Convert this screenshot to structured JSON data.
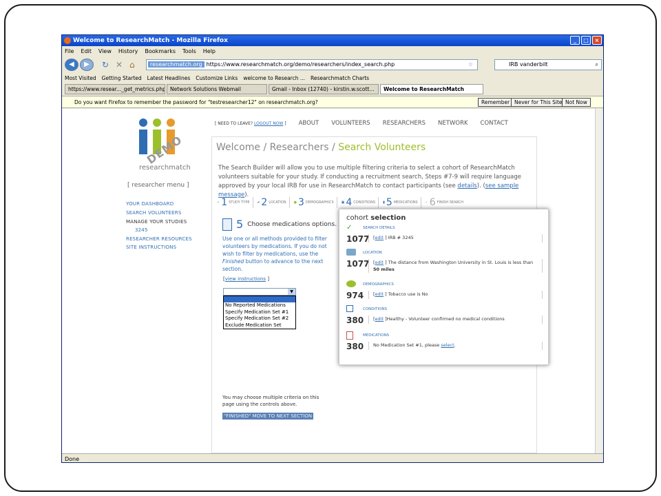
{
  "browser": {
    "title": "Welcome to ResearchMatch - Mozilla Firefox",
    "menu": [
      "File",
      "Edit",
      "View",
      "History",
      "Bookmarks",
      "Tools",
      "Help"
    ],
    "site_badge": "researchmatch.org",
    "url": "https://www.researchmatch.org/demo/researchers/index_search.php",
    "search_value": "IRB vanderbilt",
    "bookmarks": [
      "Most Visited",
      "Getting Started",
      "Latest Headlines",
      "Customize Links",
      "welcome to Research ...",
      "Researchmatch Charts"
    ],
    "tabs": [
      "https://www.resear..._get_metrics.php",
      "Network Solutions Webmail",
      "Gmail - Inbox (12740) - kirstin.w.scott...",
      "Welcome to ResearchMatch"
    ],
    "notification": "Do you want Firefox to remember the password for \"testresearcher12\" on researchmatch.org?",
    "buttons": {
      "remember": "Remember",
      "never": "Never for This Site",
      "not_now": "Not Now"
    },
    "status": "Done"
  },
  "page": {
    "logo_text": "researchmatch",
    "demo_stamp": "DEMO",
    "menu_title": "[ researcher menu ]",
    "menu_items": [
      "YOUR DASHBOARD",
      "SEARCH VOLUNTEERS",
      "MANAGE YOUR STUDIES",
      "3245",
      "RESEARCHER RESOURCES",
      "SITE INSTRUCTIONS"
    ],
    "need_leave": "[ NEED TO LEAVE?",
    "logout": "LOGOUT NOW",
    "need_leave_end": "]",
    "nav": [
      "ABOUT",
      "VOLUNTEERS",
      "RESEARCHERS",
      "NETWORK",
      "CONTACT"
    ],
    "breadcrumb": [
      "Welcome",
      "Researchers",
      "Search Volunteers"
    ],
    "intro_1": "The Search Builder will allow you to use multiple filtering criteria to select a cohort of ResearchMatch volunteers suitable for your study. If conducting a recruitment search, Steps #7-9 will require language approved by your local IRB for use in ResearchMatch to contact participants (see ",
    "intro_link1": "details",
    "intro_2": "). (",
    "intro_link2": "see sample message",
    "intro_3": ").",
    "steps": [
      {
        "num": "1",
        "label": "STUDY TYPE"
      },
      {
        "num": "2",
        "label": "LOCATION"
      },
      {
        "num": "3",
        "label": "DEMOGRAPHICS"
      },
      {
        "num": "4",
        "label": "CONDITIONS"
      },
      {
        "num": "5",
        "label": "MEDICATIONS"
      },
      {
        "num": "6",
        "label": "FINISH SEARCH"
      }
    ],
    "med_num": "5",
    "med_title": "Choose medications options.",
    "med_text_1": "Use one or all methods provided to filter volunteers by medications. If you do not wish to filter by medications, use the ",
    "med_text_em": "Finished",
    "med_text_2": " button to advance to the next section.",
    "view_instr_open": "[",
    "view_instr": "view instructions",
    "view_instr_close": "]",
    "options": [
      "No Reported Medications",
      "Specify Medication Set #1",
      "Specify Medication Set #2",
      "Exclude Medication Set"
    ],
    "bottom_text": "You may choose multiple criteria on this page using the controls above.",
    "finish_btn": "\"FINISHED\" MOVE TO NEXT SECTION"
  },
  "cohort": {
    "title_a": "cohort ",
    "title_b": "selection",
    "sections": [
      {
        "label": "SEARCH DETAILS",
        "count": "1077",
        "pre": "[",
        "edit": "edit",
        "post": "] IRB # 3245",
        "detail2": ""
      },
      {
        "label": "LOCATION",
        "count": "1077",
        "pre": "[",
        "edit": "edit",
        "post": "] The distance from Washington University in St. Louis is less than",
        "detail2": "50 miles"
      },
      {
        "label": "DEMOGRAPHICS",
        "count": "974",
        "pre": "[",
        "edit": "edit",
        "post": "] Tobacco use is No",
        "detail2": ""
      },
      {
        "label": "CONDITIONS",
        "count": "380",
        "pre": "[",
        "edit": "edit",
        "post": "]Healthy - Volunteer confirmed no medical conditions",
        "detail2": ""
      },
      {
        "label": "MEDICATIONS",
        "count": "380",
        "pre": "No Medication Set #1, please ",
        "edit": "select",
        "post": ".",
        "detail2": ""
      }
    ]
  }
}
